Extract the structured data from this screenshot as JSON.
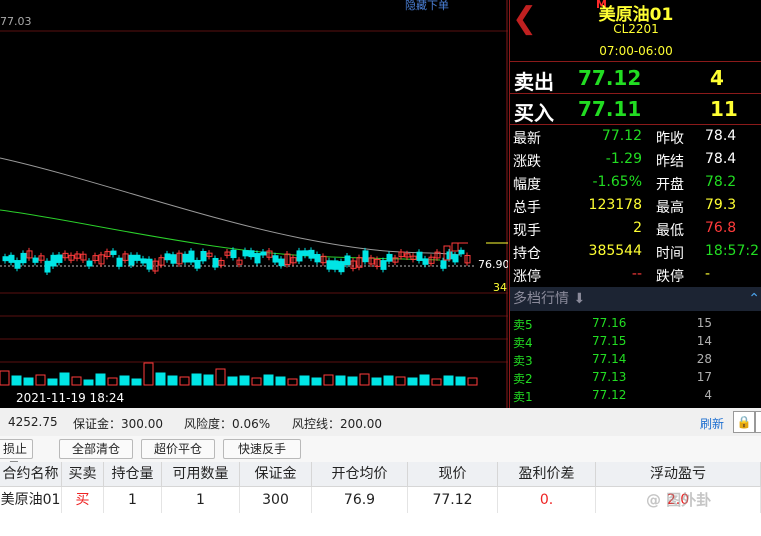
{
  "chart": {
    "top_price_label": "77.03",
    "hide_order_label": "隐藏下单",
    "last_price_tag": "76.90",
    "volume_tag": "34",
    "timestamp": "2021-11-19 18:24",
    "colors": {
      "up": "#ff3b3b",
      "down": "#00e5e5",
      "ma_long": "#9a9a9a",
      "ma_mid": "#2bd12b"
    }
  },
  "quote": {
    "badge": "M",
    "name": "美原油01",
    "code": "CL2201",
    "session": "07:00-06:00",
    "ask_label": "卖出",
    "ask_price": "77.12",
    "ask_volume": "4",
    "bid_label": "买入",
    "bid_price": "77.11",
    "bid_volume": "11",
    "rows": [
      {
        "l1": "最新",
        "v1": "77.12",
        "c1": "#22dd22",
        "l2": "昨收",
        "v2": "78.4"
      },
      {
        "l1": "涨跌",
        "v1": "-1.29",
        "c1": "#22dd22",
        "l2": "昨结",
        "v2": "78.4"
      },
      {
        "l1": "幅度",
        "v1": "-1.65%",
        "c1": "#22dd22",
        "l2": "开盘",
        "v2": "78.2"
      },
      {
        "l1": "总手",
        "v1": "123178",
        "c1": "#ffff33",
        "l2": "最高",
        "v2": "79.3"
      },
      {
        "l1": "现手",
        "v1": "2",
        "c1": "#ffff33",
        "l2": "最低",
        "v2": "76.8"
      },
      {
        "l1": "持仓",
        "v1": "385544",
        "c1": "#ffff33",
        "l2": "时间",
        "v2": "18:57:2"
      },
      {
        "l1": "涨停",
        "v1": "--",
        "c1": "#ff3b3b",
        "l2": "跌停",
        "v2": "-"
      }
    ],
    "row2_colors": [
      "#ffffff",
      "#ffffff",
      "#22dd22",
      "#ffff33",
      "#ff3b3b",
      "#22dd22",
      "#ffff33",
      "#22dd22"
    ],
    "depth_title": "多档行情",
    "depth": [
      {
        "label": "卖5",
        "price": "77.16",
        "vol": "15"
      },
      {
        "label": "卖4",
        "price": "77.15",
        "vol": "14"
      },
      {
        "label": "卖3",
        "price": "77.14",
        "vol": "28"
      },
      {
        "label": "卖2",
        "price": "77.13",
        "vol": "17"
      },
      {
        "label": "卖1",
        "price": "77.12",
        "vol": "4"
      }
    ]
  },
  "account": {
    "balance": "4252.75",
    "margin": "保证金：300.00",
    "risk": "风险度：0.06%",
    "risk_line": "风控线：200.00",
    "refresh": "刷新"
  },
  "toolbar": {
    "stop_tab": "损止盈",
    "close_all": "全部清仓",
    "super_close": "超价平仓",
    "quick_reverse": "快速反手"
  },
  "table": {
    "headers": [
      "合约名称",
      "买卖",
      "持仓量",
      "可用数量",
      "保证金",
      "开仓均价",
      "现价",
      "盈利价差",
      "浮动盈亏"
    ],
    "row": [
      "美原油01",
      "买",
      "1",
      "1",
      "300",
      "76.9",
      "77.12",
      "0.",
      "2.0"
    ]
  },
  "watermark": "@ 图外卦"
}
